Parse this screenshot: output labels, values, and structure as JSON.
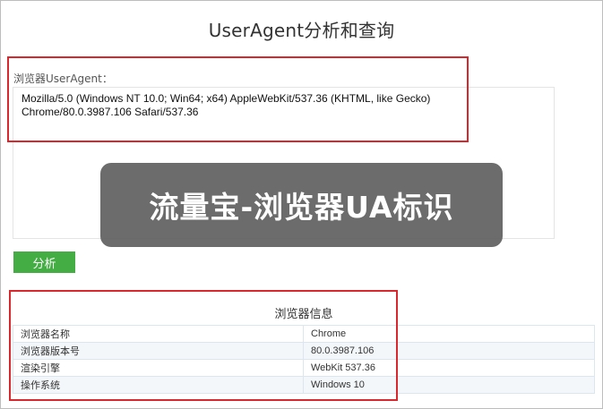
{
  "header": {
    "title": "UserAgent分析和查询"
  },
  "ua_form": {
    "label": "浏览器UserAgent：",
    "value": "Mozilla/5.0 (Windows NT 10.0; Win64; x64) AppleWebKit/537.36 (KHTML, like Gecko)\nChrome/80.0.3987.106 Safari/537.36",
    "analyze_label": "分析"
  },
  "overlay_caption": "流量宝-浏览器UA标识",
  "info": {
    "title": "浏览器信息",
    "rows": [
      {
        "label": "浏览器名称",
        "value": "Chrome"
      },
      {
        "label": "浏览器版本号",
        "value": "80.0.3987.106"
      },
      {
        "label": "渲染引擎",
        "value": "WebKit 537.36"
      },
      {
        "label": "操作系统",
        "value": "Windows 10"
      }
    ]
  },
  "colors": {
    "highlight_border": "#d9272e",
    "button_green": "#44ad44",
    "overlay_bg": "#5c5c5c"
  }
}
